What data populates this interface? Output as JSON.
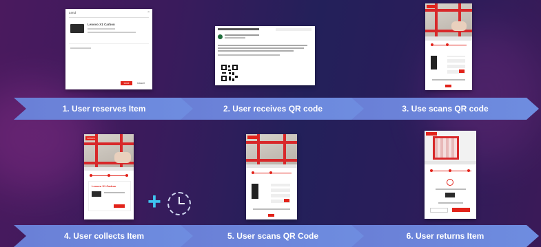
{
  "steps": [
    {
      "label": "1. User reserves Item"
    },
    {
      "label": "2. User receives QR code"
    },
    {
      "label": "3. Use scans QR code"
    },
    {
      "label": "4. User collects Item"
    },
    {
      "label": "5. User scans QR Code"
    },
    {
      "label": "6. User returns Item"
    }
  ],
  "reserve_dialog": {
    "title": "Lend",
    "item_name": "Lenovo X1 Carbon",
    "confirm_label": "Lend",
    "cancel_label": "Cancel"
  },
  "item_card": {
    "brand": "Lenovo",
    "item_name": "Lenovo X1 Carbon"
  },
  "colors": {
    "accent": "#e2231a",
    "banner": "#6e8de0",
    "plus": "#3ec4f0"
  },
  "icons": {
    "plus": "plus-icon",
    "clock": "clock-icon"
  }
}
